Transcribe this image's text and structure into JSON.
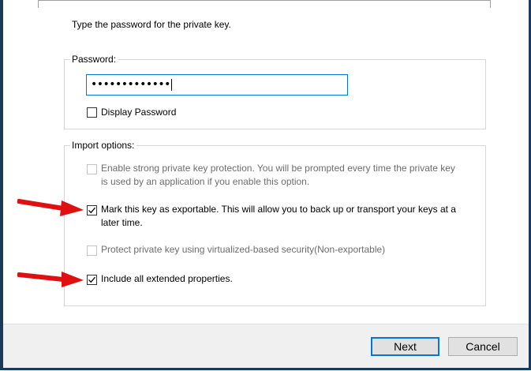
{
  "dialog": {
    "instruction": "Type the password for the private key."
  },
  "password_group": {
    "legend": "Password:",
    "masked_value": "•••••••••••••",
    "display_password_label": "Display Password",
    "display_password_checked": false
  },
  "import_options": {
    "legend": "Import options:",
    "options": [
      {
        "label": "Enable strong private key protection. You will be prompted every time the private key is used by an application if you enable this option.",
        "checked": false,
        "enabled": false
      },
      {
        "label": "Mark this key as exportable. This will allow you to back up or transport your keys at a later time.",
        "checked": true,
        "enabled": true
      },
      {
        "label": "Protect private key using virtualized-based security(Non-exportable)",
        "checked": false,
        "enabled": false
      },
      {
        "label": "Include all extended properties.",
        "checked": true,
        "enabled": true
      }
    ]
  },
  "buttons": {
    "next_label": "Next",
    "cancel_label": "Cancel"
  },
  "colors": {
    "accent": "#0078d7",
    "arrow": "#e01010",
    "frame": "#1a3a5c"
  },
  "icons": {
    "annotation_arrows": [
      "red-arrow-icon",
      "red-arrow-icon"
    ]
  }
}
